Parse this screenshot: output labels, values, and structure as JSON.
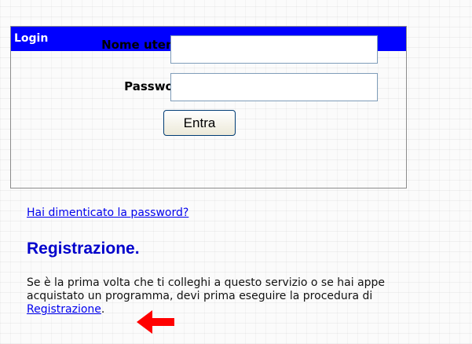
{
  "login": {
    "header": "Login",
    "username_label": "Nome utente:",
    "username_value": "",
    "password_label": "Password:",
    "password_value": "",
    "submit_label": "Entra"
  },
  "forgot_password_link": "Hai dimenticato la password?",
  "registration": {
    "title": "Registrazione.",
    "text_line1": "Se è la prima volta che ti colleghi a questo servizio o se hai appe",
    "text_line2": "acquistato un programma, devi prima eseguire la procedura di",
    "link": "Registrazione",
    "link_suffix": "."
  },
  "annotation": {
    "arrow_color": "#ff0000",
    "arrow_icon": "left-arrow-icon"
  },
  "colors": {
    "header_bg": "#0000ff",
    "link": "#0000ee",
    "title": "#0000cc"
  }
}
